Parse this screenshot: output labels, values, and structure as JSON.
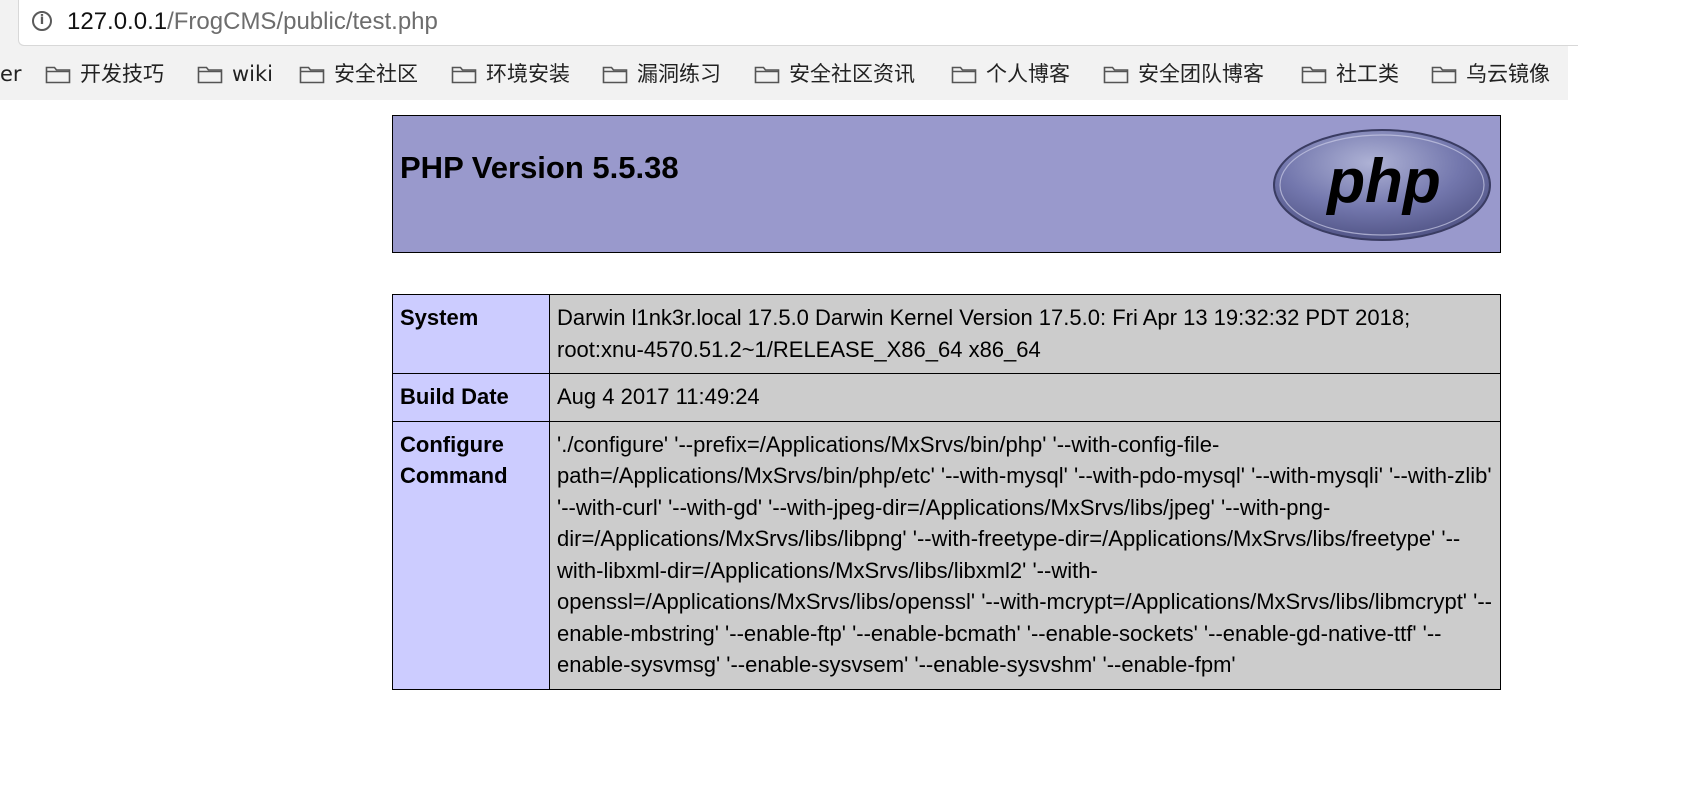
{
  "browser": {
    "url_host": "127.0.0.1",
    "url_path": "/FrogCMS/public/test.php",
    "bookmarks_cut_label": "er",
    "bookmarks": [
      {
        "label": "开发技巧"
      },
      {
        "label": "wiki"
      },
      {
        "label": "安全社区"
      },
      {
        "label": "环境安装"
      },
      {
        "label": "漏洞练习"
      },
      {
        "label": "安全社区资讯"
      },
      {
        "label": "个人博客"
      },
      {
        "label": "安全团队博客"
      },
      {
        "label": "社工类"
      },
      {
        "label": "乌云镜像"
      }
    ]
  },
  "phpinfo": {
    "title": "PHP Version 5.5.38",
    "logo_text": "php",
    "rows": [
      {
        "key": "System",
        "value": "Darwin l1nk3r.local 17.5.0 Darwin Kernel Version 17.5.0: Fri Apr 13 19:32:32 PDT 2018; root:xnu-4570.51.2~1/RELEASE_X86_64 x86_64"
      },
      {
        "key": "Build Date",
        "value": "Aug 4 2017 11:49:24"
      },
      {
        "key": "Configure Command",
        "value": "'./configure' '--prefix=/Applications/MxSrvs/bin/php' '--with-config-file-path=/Applications/MxSrvs/bin/php/etc' '--with-mysql' '--with-pdo-mysql' '--with-mysqli' '--with-zlib' '--with-curl' '--with-gd' '--with-jpeg-dir=/Applications/MxSrvs/libs/jpeg' '--with-png-dir=/Applications/MxSrvs/libs/libpng' '--with-freetype-dir=/Applications/MxSrvs/libs/freetype' '--with-libxml-dir=/Applications/MxSrvs/libs/libxml2' '--with-openssl=/Applications/MxSrvs/libs/openssl' '--with-mcrypt=/Applications/MxSrvs/libs/libmcrypt' '--enable-mbstring' '--enable-ftp' '--enable-bcmath' '--enable-sockets' '--enable-gd-native-ttf' '--enable-sysvmsg' '--enable-sysvsem' '--enable-sysvshm' '--enable-fpm'"
      }
    ]
  }
}
